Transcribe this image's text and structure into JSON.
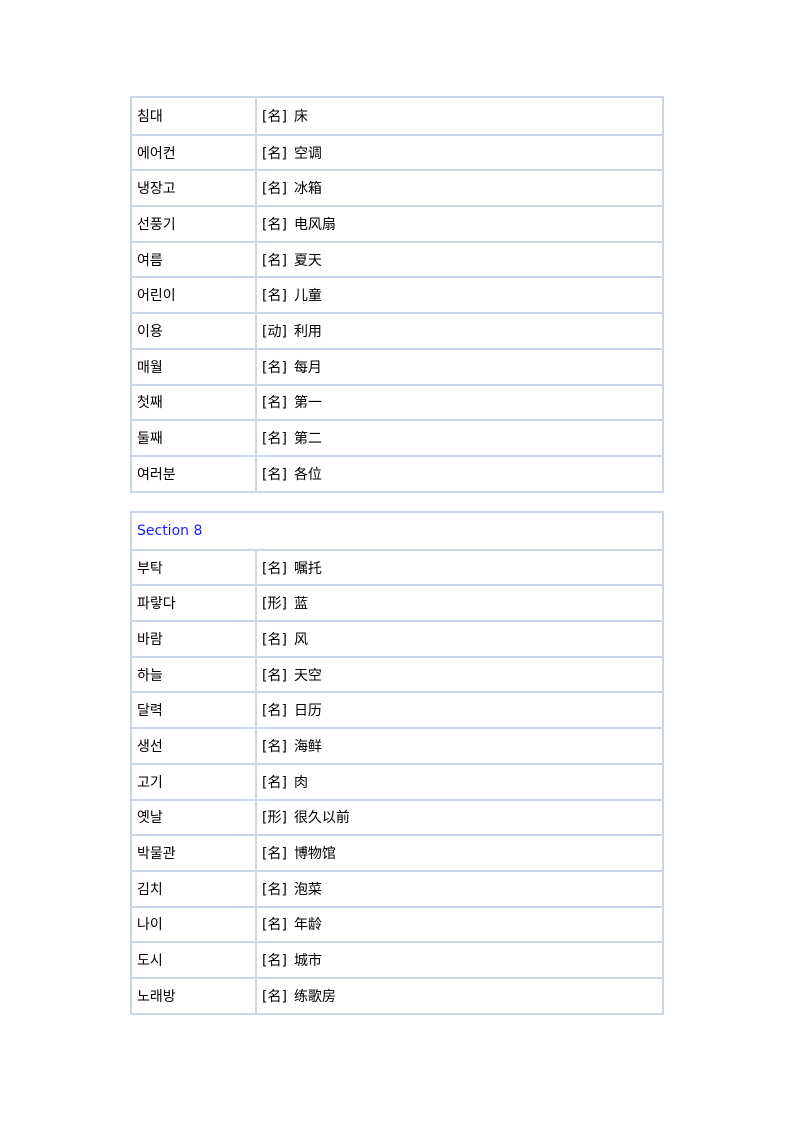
{
  "table1": [
    {
      "ko": "침대",
      "pos": "[名]",
      "zh": "床"
    },
    {
      "ko": "에어컨",
      "pos": "[名]",
      "zh": "空调"
    },
    {
      "ko": "냉장고",
      "pos": "[名]",
      "zh": "冰箱"
    },
    {
      "ko": "선풍기",
      "pos": "[名]",
      "zh": "电风扇"
    },
    {
      "ko": "여름",
      "pos": "[名]",
      "zh": "夏天"
    },
    {
      "ko": "어린이",
      "pos": "[名]",
      "zh": "儿童"
    },
    {
      "ko": "이용",
      "pos": "[动]",
      "zh": "利用"
    },
    {
      "ko": "매월",
      "pos": "[名]",
      "zh": "每月"
    },
    {
      "ko": "첫째",
      "pos": "[名]",
      "zh": "第一"
    },
    {
      "ko": "둘째",
      "pos": "[名]",
      "zh": "第二"
    },
    {
      "ko": "여러분",
      "pos": "[名]",
      "zh": "各位"
    }
  ],
  "table2": {
    "section_title": "Section 8",
    "section_color": "#1a1aff",
    "rows": [
      {
        "ko": "부탁",
        "pos": "[名]",
        "zh": "嘱托"
      },
      {
        "ko": "파랗다",
        "pos": "[形]",
        "zh": "蓝"
      },
      {
        "ko": "바람",
        "pos": "[名]",
        "zh": "风"
      },
      {
        "ko": "하늘",
        "pos": "[名]",
        "zh": "天空"
      },
      {
        "ko": "달력",
        "pos": "[名]",
        "zh": "日历"
      },
      {
        "ko": "생선",
        "pos": "[名]",
        "zh": "海鲜"
      },
      {
        "ko": "고기",
        "pos": "[名]",
        "zh": "肉"
      },
      {
        "ko": "옛날",
        "pos": "[形]",
        "zh": "很久以前"
      },
      {
        "ko": "박물관",
        "pos": "[名]",
        "zh": "博物馆"
      },
      {
        "ko": "김치",
        "pos": "[名]",
        "zh": "泡菜"
      },
      {
        "ko": "나이",
        "pos": "[名]",
        "zh": "年龄"
      },
      {
        "ko": "도시",
        "pos": "[名]",
        "zh": "城市"
      },
      {
        "ko": "노래방",
        "pos": "[名]",
        "zh": "练歌房"
      }
    ]
  }
}
